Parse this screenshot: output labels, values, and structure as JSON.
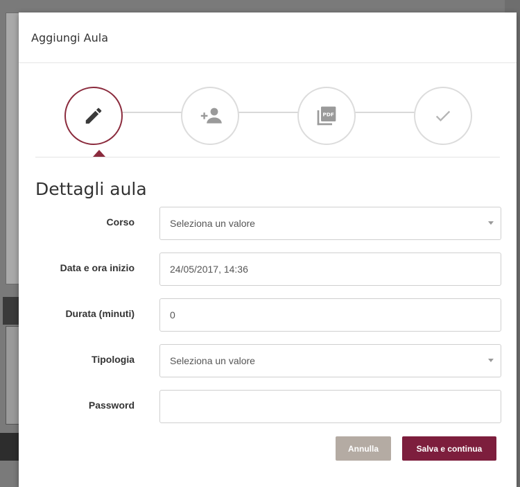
{
  "modal": {
    "title": "Aggiungi Aula"
  },
  "stepper": {
    "steps": [
      {
        "icon": "pencil-icon",
        "active": true
      },
      {
        "icon": "add-user-icon",
        "active": false
      },
      {
        "icon": "pdf-icon",
        "active": false
      },
      {
        "icon": "check-icon",
        "active": false
      }
    ],
    "active_color": "#8b2b3d",
    "inactive_color": "#dcdcdc"
  },
  "form": {
    "section_title": "Dettagli aula",
    "fields": {
      "corso": {
        "label": "Corso",
        "value": "Seleziona un valore"
      },
      "data_inizio": {
        "label": "Data e ora inizio",
        "value": "24/05/2017, 14:36"
      },
      "durata": {
        "label": "Durata (minuti)",
        "value": "0"
      },
      "tipologia": {
        "label": "Tipologia",
        "value": "Seleziona un valore"
      },
      "password": {
        "label": "Password",
        "value": ""
      }
    }
  },
  "actions": {
    "cancel_label": "Annulla",
    "save_label": "Salva e continua",
    "cancel_color": "#b4aba3",
    "save_color": "#7d1e3d"
  }
}
